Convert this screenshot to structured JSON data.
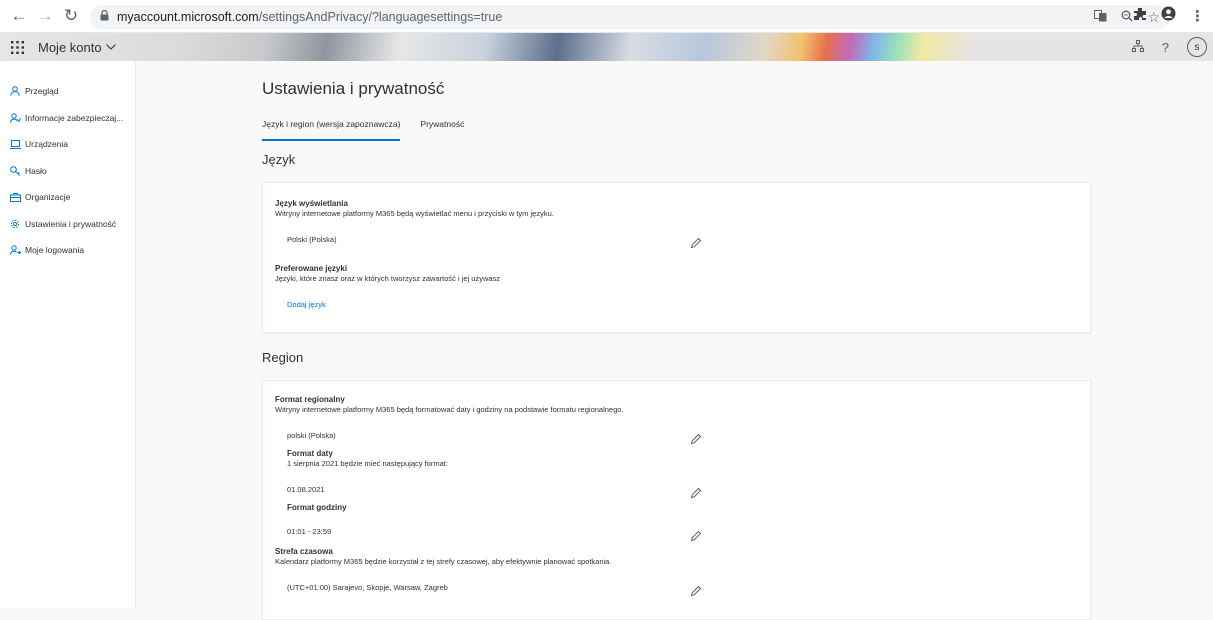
{
  "browser": {
    "url_host": "myaccount.microsoft.com",
    "url_path": "/settingsAndPrivacy/?languagesettings=true"
  },
  "header": {
    "app_title": "Moje konto",
    "avatar_initial": "s"
  },
  "sidebar": {
    "items": [
      {
        "label": "Przegląd",
        "icon": "person-icon"
      },
      {
        "label": "Informacje zabezpieczaj...",
        "icon": "security-info-icon"
      },
      {
        "label": "Urządzenia",
        "icon": "laptop-icon"
      },
      {
        "label": "Hasło",
        "icon": "key-icon"
      },
      {
        "label": "Organizacje",
        "icon": "briefcase-icon"
      },
      {
        "label": "Ustawienia i prywatność",
        "icon": "gear-icon"
      },
      {
        "label": "Moje logowania",
        "icon": "sign-ins-icon"
      }
    ]
  },
  "main": {
    "title": "Ustawienia i prywatność",
    "tabs": [
      {
        "label": "Język i region (wersja zapoznawcza)",
        "active": true
      },
      {
        "label": "Prywatność",
        "active": false
      }
    ],
    "language": {
      "heading": "Język",
      "display_title": "Język wyświetlania",
      "display_desc": "Witryny internetowe platformy M365 będą wyświetlać menu i przyciski w tym języku.",
      "display_value": "Polski (Polska)",
      "preferred_title": "Preferowane języki",
      "preferred_desc": "Języki, które znasz oraz w których tworzysz zawartość i jej używasz",
      "add_language": "Dodaj język"
    },
    "region": {
      "heading": "Region",
      "format_title": "Format regionalny",
      "format_desc": "Witryny internetowe platformy M365 będą formatować daty i godziny na podstawie formatu regionalnego.",
      "format_value": "polski (Polska)",
      "date_title": "Format daty",
      "date_desc": "1 sierpnia 2021 będzie mieć następujący format:",
      "date_value": "01.08.2021",
      "time_title": "Format godziny",
      "time_value": "01:01 - 23:59",
      "tz_title": "Strefa czasowa",
      "tz_desc": "Kalendarz platformy M365 będzie korzystał z tej strefy czasowej, aby efektywnie planować spotkania.",
      "tz_value": "(UTC+01:00) Sarajevo, Skopje, Warsaw, Zagreb"
    }
  }
}
